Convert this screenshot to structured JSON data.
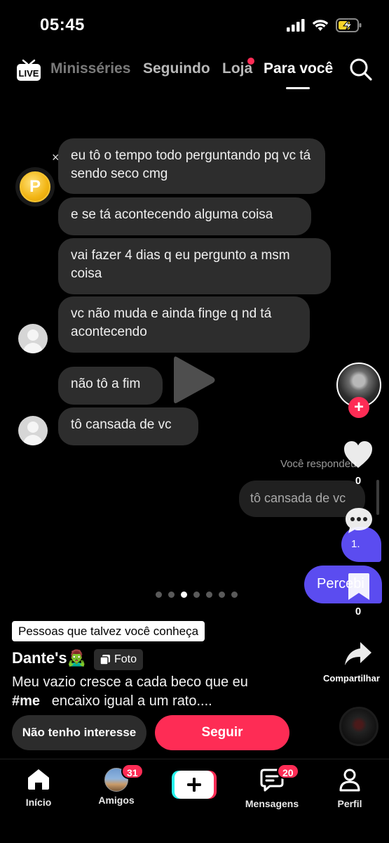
{
  "status_bar": {
    "time": "05:45"
  },
  "top_nav": {
    "live_label": "LIVE",
    "tabs": [
      {
        "label": "Minisséries"
      },
      {
        "label": "Seguindo"
      },
      {
        "label": "Loja"
      },
      {
        "label": "Para você"
      }
    ],
    "active_tab": "Para você"
  },
  "chat": {
    "close_symbol": "×",
    "coin_letter": "P",
    "messages": [
      "eu tô o tempo todo perguntando pq vc tá sendo seco cmg",
      "e se tá acontecendo alguma coisa",
      "vai fazer 4 dias q eu pergunto a msm coisa",
      "vc não muda e ainda finge q nd tá acontecendo",
      "não tô a fim",
      "tô cansada de vc"
    ],
    "you_replied_label": "Você respondeu",
    "reply_text": "tô cansada de vc",
    "small_bubble_text": "1.",
    "big_bubble_text": "Percebi"
  },
  "actions": {
    "likes": "0",
    "saves": "0",
    "share_label": "Compartilhar"
  },
  "carousel": {
    "total": 7,
    "active_index": 2
  },
  "post": {
    "suggestion_label": "Pessoas que talvez você conheça",
    "author": "Dante's🧟‍♂️",
    "type_badge": "Foto",
    "caption_line1": "Meu vazio cresce a cada beco que eu",
    "hashtag": "#me",
    "caption_line2": "encaixo  igual a um rato....",
    "not_interested_label": "Não tenho interesse",
    "follow_label": "Seguir"
  },
  "bottom_nav": {
    "home": "Início",
    "friends": "Amigos",
    "friends_badge": "31",
    "messages": "Mensagens",
    "messages_badge": "20",
    "profile": "Perfil"
  },
  "colors": {
    "accent_red": "#fe2c55",
    "accent_cyan": "#25f4ee",
    "bubble_gray": "#2d2d2d",
    "purple": "#5b4cf0"
  }
}
